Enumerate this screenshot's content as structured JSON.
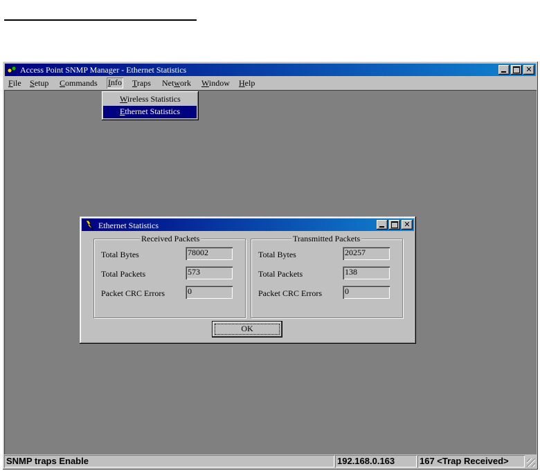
{
  "main_window": {
    "title": "Access Point SNMP Manager -  Ethernet Statistics",
    "controls": {
      "minimize": "minimize-icon",
      "maximize": "maximize-icon",
      "close": "✕"
    }
  },
  "menubar": {
    "file": {
      "hotkey": "F",
      "rest": "ile"
    },
    "setup": {
      "hotkey": "S",
      "rest": "etup"
    },
    "commands": {
      "hotkey": "C",
      "rest": "ommands"
    },
    "info": {
      "hotkey": "I",
      "rest": "nfo"
    },
    "traps": {
      "hotkey": "T",
      "rest": "raps"
    },
    "network": {
      "pre": "Net",
      "hotkey": "w",
      "rest": "ork"
    },
    "window": {
      "hotkey": "W",
      "rest": "indow"
    },
    "help": {
      "hotkey": "H",
      "rest": "elp"
    }
  },
  "info_menu": {
    "wireless": {
      "hotkey": "W",
      "rest": "ireless Statistics"
    },
    "ethernet": {
      "hotkey": "E",
      "rest": "thernet Statistics"
    }
  },
  "dialog": {
    "title": "Ethernet Statistics",
    "received": {
      "legend": "Received Packets",
      "total_bytes_label": "Total Bytes",
      "total_bytes": "78002",
      "total_packets_label": "Total Packets",
      "total_packets": "573",
      "crc_label": "Packet CRC Errors",
      "crc_errors": "0"
    },
    "transmitted": {
      "legend": "Transmitted Packets",
      "total_bytes_label": "Total Bytes",
      "total_bytes": "20257",
      "total_packets_label": "Total Packets",
      "total_packets": "138",
      "crc_label": "Packet CRC Errors",
      "crc_errors": "0"
    },
    "ok_label": "OK"
  },
  "statusbar": {
    "status": "SNMP traps Enable",
    "ip": "192.168.0.163",
    "traps": "167 <Trap Received>"
  }
}
